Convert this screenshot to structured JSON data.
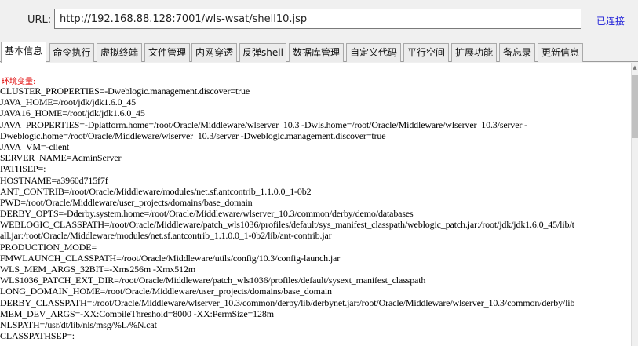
{
  "topbar": {
    "url_label": "URL:",
    "url_value": "http://192.168.88.128:7001/wls-wsat/shell10.jsp",
    "status": "已连接"
  },
  "tabs": [
    {
      "label": "基本信息",
      "active": true
    },
    {
      "label": "命令执行"
    },
    {
      "label": "虚拟终端"
    },
    {
      "label": "文件管理"
    },
    {
      "label": "内网穿透"
    },
    {
      "label": "反弹shell"
    },
    {
      "label": "数据库管理"
    },
    {
      "label": "自定义代码"
    },
    {
      "label": "平行空间"
    },
    {
      "label": "扩展功能"
    },
    {
      "label": "备忘录"
    },
    {
      "label": "更新信息"
    }
  ],
  "content": {
    "env_title": "环境变量:",
    "lines": [
      "CLUSTER_PROPERTIES=-Dweblogic.management.discover=true",
      "JAVA_HOME=/root/jdk/jdk1.6.0_45",
      "JAVA16_HOME=/root/jdk/jdk1.6.0_45",
      "JAVA_PROPERTIES=-Dplatform.home=/root/Oracle/Middleware/wlserver_10.3 -Dwls.home=/root/Oracle/Middleware/wlserver_10.3/server -",
      "Dweblogic.home=/root/Oracle/Middleware/wlserver_10.3/server -Dweblogic.management.discover=true",
      "JAVA_VM=-client",
      "SERVER_NAME=AdminServer",
      "PATHSEP=:",
      "HOSTNAME=a3960d715f7f",
      "ANT_CONTRIB=/root/Oracle/Middleware/modules/net.sf.antcontrib_1.1.0.0_1-0b2",
      "PWD=/root/Oracle/Middleware/user_projects/domains/base_domain",
      "DERBY_OPTS=-Dderby.system.home=/root/Oracle/Middleware/wlserver_10.3/common/derby/demo/databases",
      "WEBLOGIC_CLASSPATH=/root/Oracle/Middleware/patch_wls1036/profiles/default/sys_manifest_classpath/weblogic_patch.jar:/root/jdk/jdk1.6.0_45/lib/t",
      "all.jar:/root/Oracle/Middleware/modules/net.sf.antcontrib_1.1.0.0_1-0b2/lib/ant-contrib.jar",
      "PRODUCTION_MODE=",
      "FMWLAUNCH_CLASSPATH=/root/Oracle/Middleware/utils/config/10.3/config-launch.jar",
      "WLS_MEM_ARGS_32BIT=-Xms256m -Xmx512m",
      "WLS1036_PATCH_EXT_DIR=/root/Oracle/Middleware/patch_wls1036/profiles/default/sysext_manifest_classpath",
      "LONG_DOMAIN_HOME=/root/Oracle/Middleware/user_projects/domains/base_domain",
      "DERBY_CLASSPATH=:/root/Oracle/Middleware/wlserver_10.3/common/derby/lib/derbynet.jar:/root/Oracle/Middleware/wlserver_10.3/common/derby/lib",
      "MEM_DEV_ARGS=-XX:CompileThreshold=8000 -XX:PermSize=128m",
      "NLSPATH=/usr/dt/lib/nls/msg/%L/%N.cat",
      "CLASSPATHSEP=:"
    ]
  }
}
